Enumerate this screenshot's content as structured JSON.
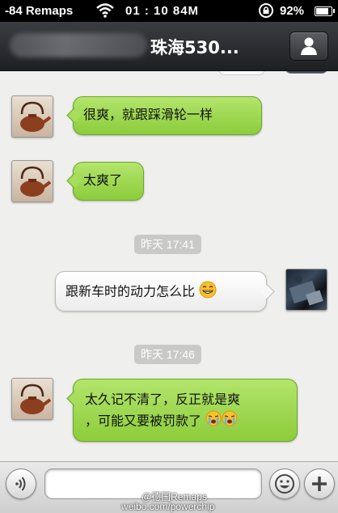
{
  "status_bar": {
    "carrier": "-84 Remaps",
    "time": "01 : 10",
    "signal_text": "84M",
    "battery_percent": "92%",
    "battery_level": 0.92
  },
  "nav": {
    "title": "珠海530..."
  },
  "messages": [
    {
      "side": "left",
      "text": "很爽，就跟踩滑轮一样"
    },
    {
      "side": "left",
      "text": "太爽了"
    },
    {
      "type": "timestamp",
      "text": "昨天 17:41"
    },
    {
      "side": "right",
      "text": "跟新车时的动力怎么比"
    },
    {
      "type": "timestamp",
      "text": "昨天 17:46"
    },
    {
      "side": "left",
      "line1": "太久记不清了，反正就是爽",
      "line2": "，可能又要被罚款了"
    }
  ],
  "watermark": {
    "line1": "@德国Remaps",
    "line2": "weibo.com/powerchip"
  },
  "colors": {
    "green_bubble": "#9ed64f",
    "nav_bar": "#2b2c30",
    "background": "#efefed"
  },
  "icons": {
    "wifi": "wifi-icon",
    "lock": "rotation-lock-icon",
    "profile": "person-icon",
    "voice": "voice-icon",
    "emoji": "smiley-icon",
    "add": "plus-icon"
  }
}
